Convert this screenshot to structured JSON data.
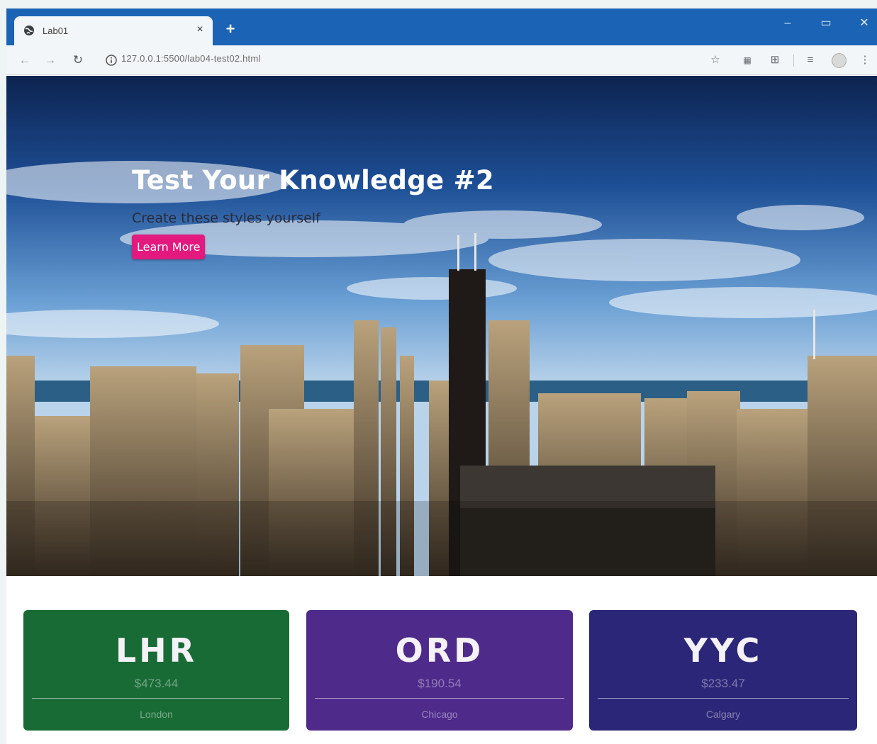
{
  "browser": {
    "tab_title": "Lab01",
    "tab_close": "×",
    "new_tab": "+",
    "url": "127.0.0.1:5500/lab04-test02.html",
    "icons": [
      "globe-icon",
      "close-icon",
      "plus-icon",
      "minimize-icon",
      "maximize-icon",
      "window-close-icon",
      "back-icon",
      "forward-icon",
      "reload-icon",
      "info-icon",
      "star-icon",
      "extension-icon",
      "grid-icon",
      "reading-list-icon",
      "profile-icon",
      "more-icon"
    ]
  },
  "hero": {
    "title": "Test Your Knowledge #2",
    "subtitle": "Create these styles yourself",
    "cta_label": "Learn More",
    "cta_color": "#e3197f"
  },
  "cards": [
    {
      "code": "LHR",
      "price": "$473.44",
      "city": "London",
      "color": "#196b35"
    },
    {
      "code": "ORD",
      "price": "$190.54",
      "city": "Chicago",
      "color": "#4e2a8a"
    },
    {
      "code": "YYC",
      "price": "$233.47",
      "city": "Calgary",
      "color": "#2b2677"
    }
  ]
}
